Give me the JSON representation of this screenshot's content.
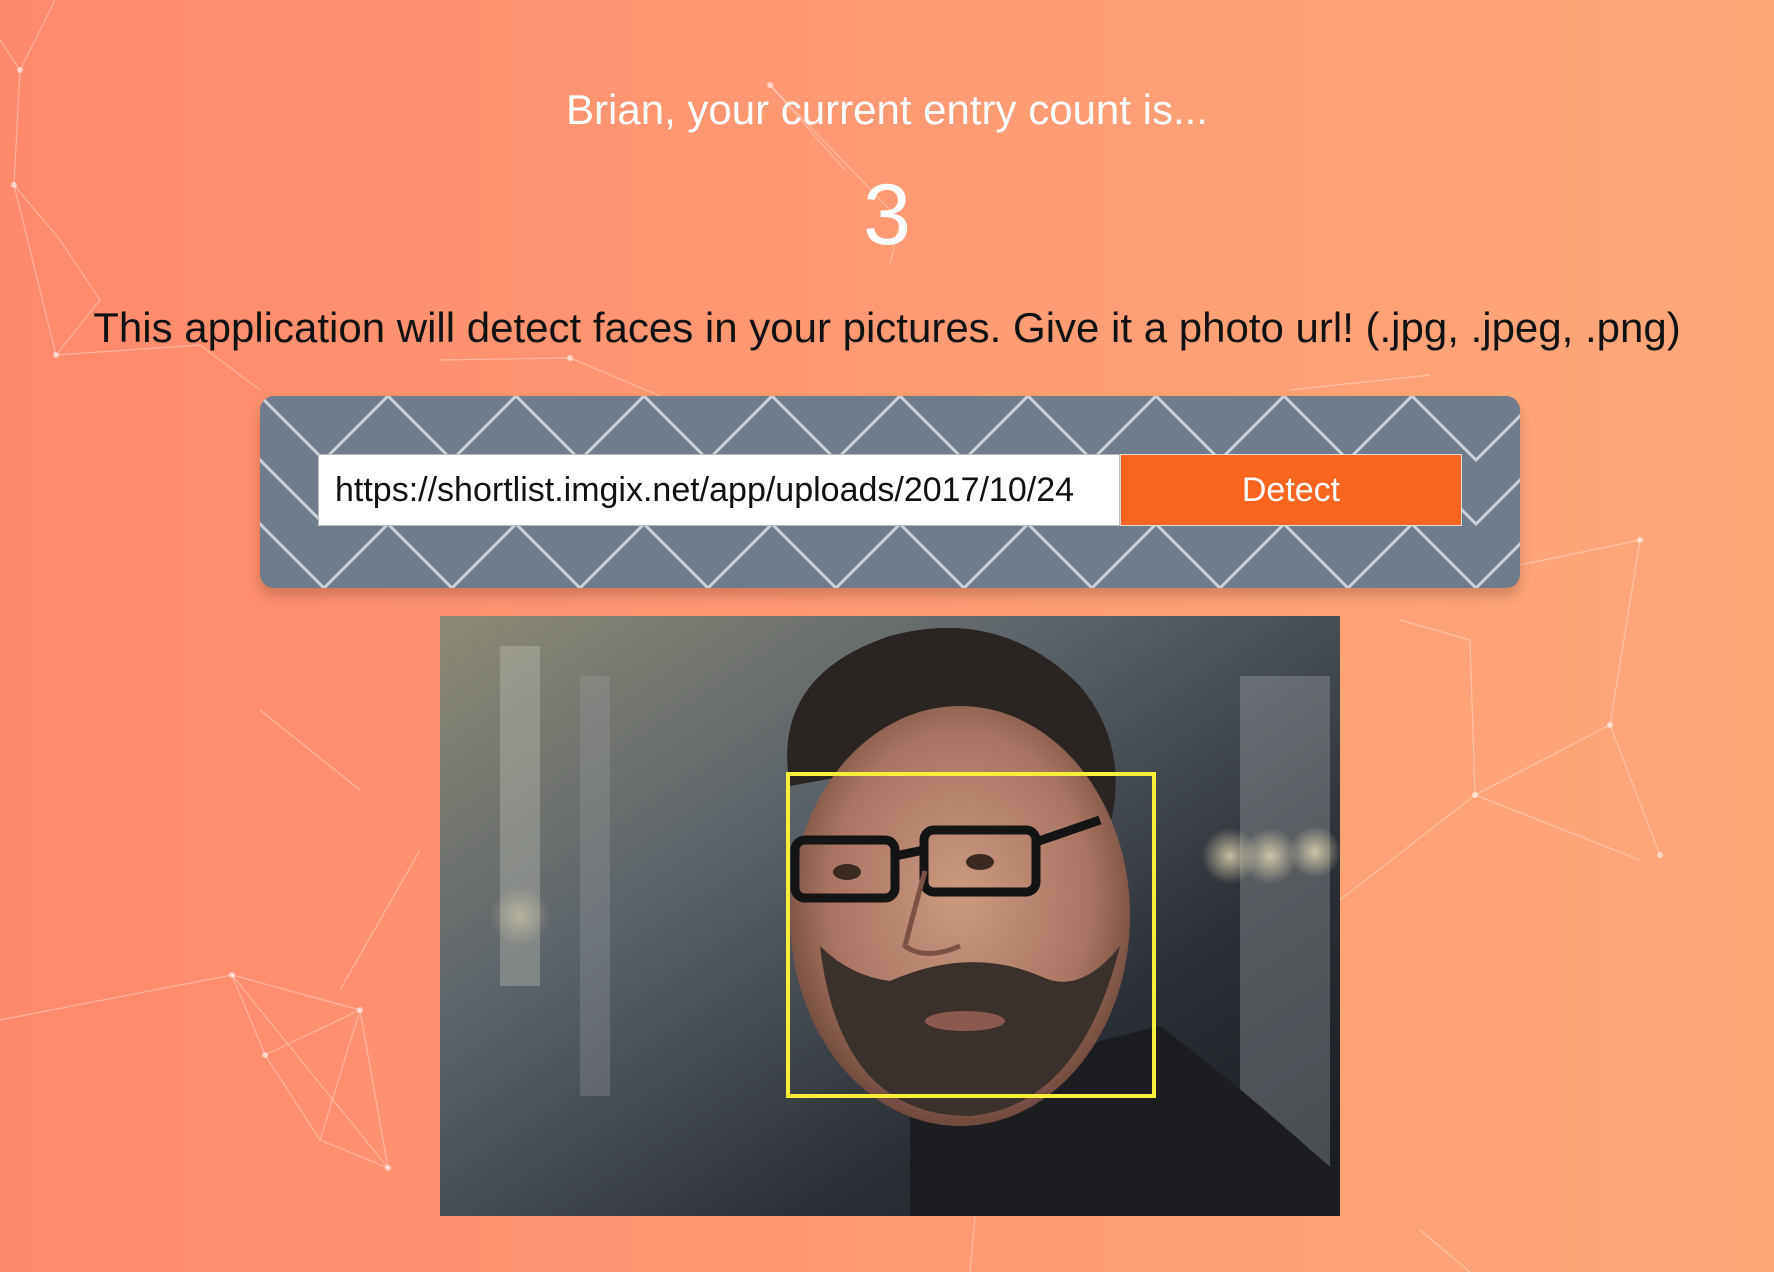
{
  "greeting": {
    "text": "Brian, your current entry count is..."
  },
  "entry_count": {
    "value": "3"
  },
  "instructions": {
    "text": "This application will detect faces in your pictures. Give it a photo url! (.jpg, .jpeg, .png)"
  },
  "url_form": {
    "input_value": "https://shortlist.imgix.net/app/uploads/2017/10/24",
    "detect_label": "Detect"
  },
  "colors": {
    "background_start": "#fe8a6a",
    "background_end": "#fea878",
    "panel": "#6e7c8b",
    "detect_button": "#fb6520",
    "face_box": "#f7f03a"
  },
  "detection": {
    "faces_detected": 1
  }
}
